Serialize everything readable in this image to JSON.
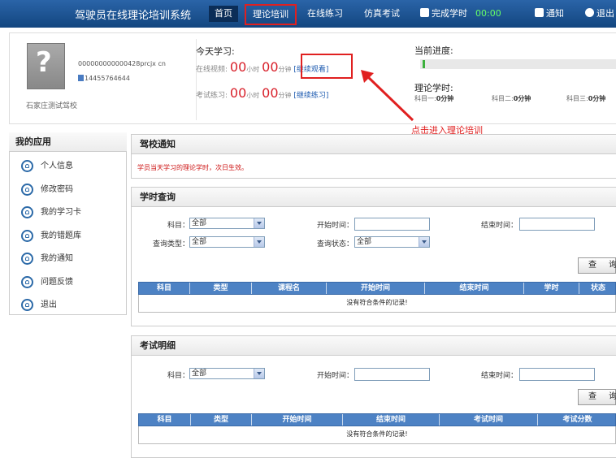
{
  "header": {
    "app_title": "驾驶员在线理论培训系统",
    "nav": {
      "home": "首页",
      "theory": "理论培训",
      "online_practice": "在线练习",
      "mock_exam": "仿真考试",
      "completed_hours_label": "完成学时",
      "completed_hours_value": "00:00",
      "notice": "通知",
      "exit": "退出"
    }
  },
  "profile": {
    "user_id": "000000000000428prcjx cn",
    "phone": "14455764644",
    "school": "石家庄测试驾校"
  },
  "today_study": {
    "title": "今天学习:",
    "video_label": "在线视频:",
    "practice_label": "考试练习:",
    "hours_value": "00",
    "hours_unit": "小时",
    "minutes_value": "00",
    "minutes_unit": "分钟",
    "video_link": "[继续观看]",
    "practice_link": "[继续练习]"
  },
  "progress": {
    "title": "当前进度:",
    "percent": 1,
    "colors": {
      "fill": "#3cb03c",
      "track": "#e8e8e8"
    }
  },
  "theory_hours": {
    "title": "理论学时:",
    "subjects": [
      {
        "label": "科目一:",
        "value": "0分钟"
      },
      {
        "label": "科目二:",
        "value": "0分钟"
      },
      {
        "label": "科目三:",
        "value": "0分钟"
      }
    ]
  },
  "annotation": {
    "text": "点击进入理论培训",
    "color": "#e02020"
  },
  "sidebar": {
    "title": "我的应用",
    "items": [
      "个人信息",
      "修改密码",
      "我的学习卡",
      "我的错题库",
      "我的通知",
      "问题反馈",
      "退出"
    ]
  },
  "school_notice": {
    "title": "驾校通知",
    "text": "学员当天学习的理论学时，次日生效。"
  },
  "hours_query": {
    "title": "学时查询",
    "subject_label": "科目：",
    "subject_value": "全部",
    "start_label": "开始时间：",
    "end_label": "结束时间：",
    "type_label": "查询类型：",
    "type_value": "全部",
    "status_label": "查询状态：",
    "status_value": "全部",
    "query_button": "查 询",
    "columns": [
      "科目",
      "类型",
      "课程名",
      "开始时间",
      "结束时间",
      "学时",
      "状态"
    ],
    "empty_text": "没有符合条件的记录!"
  },
  "exam_detail": {
    "title": "考试明细",
    "subject_label": "科目：",
    "subject_value": "全部",
    "start_label": "开始时间：",
    "end_label": "结束时间：",
    "query_button": "查 询",
    "columns": [
      "科目",
      "类型",
      "开始时间",
      "结束时间",
      "考试时间",
      "考试分数"
    ],
    "empty_text": "没有符合条件的记录!"
  }
}
